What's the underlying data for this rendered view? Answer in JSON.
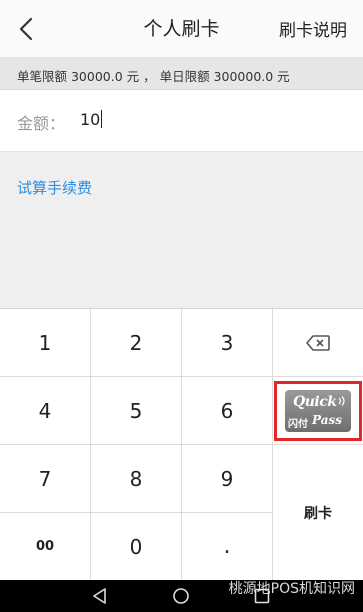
{
  "header": {
    "title": "个人刷卡",
    "help_label": "刷卡说明"
  },
  "limits": {
    "text": "单笔限额  30000.0 元 ，  单日限额  300000.0 元"
  },
  "amount": {
    "label": "金额：",
    "value": "10"
  },
  "fee_link": "试算手续费",
  "keypad": {
    "keys": [
      "1",
      "2",
      "3",
      "4",
      "5",
      "6",
      "7",
      "8",
      "9",
      "00",
      "0",
      "."
    ],
    "swipe_label": "刷卡",
    "quickpass": {
      "quick": "Quick",
      "cn": "闪付",
      "pass": "Pass"
    }
  },
  "watermark": "桃源地POS机知识网",
  "colors": {
    "accent": "#2e8ee0",
    "highlight": "#e02828",
    "navbar": "#000000"
  },
  "icons": [
    "chevron-left-icon",
    "backspace-icon",
    "quickpass-logo",
    "nav-back-icon",
    "nav-home-icon",
    "nav-recent-icon"
  ]
}
